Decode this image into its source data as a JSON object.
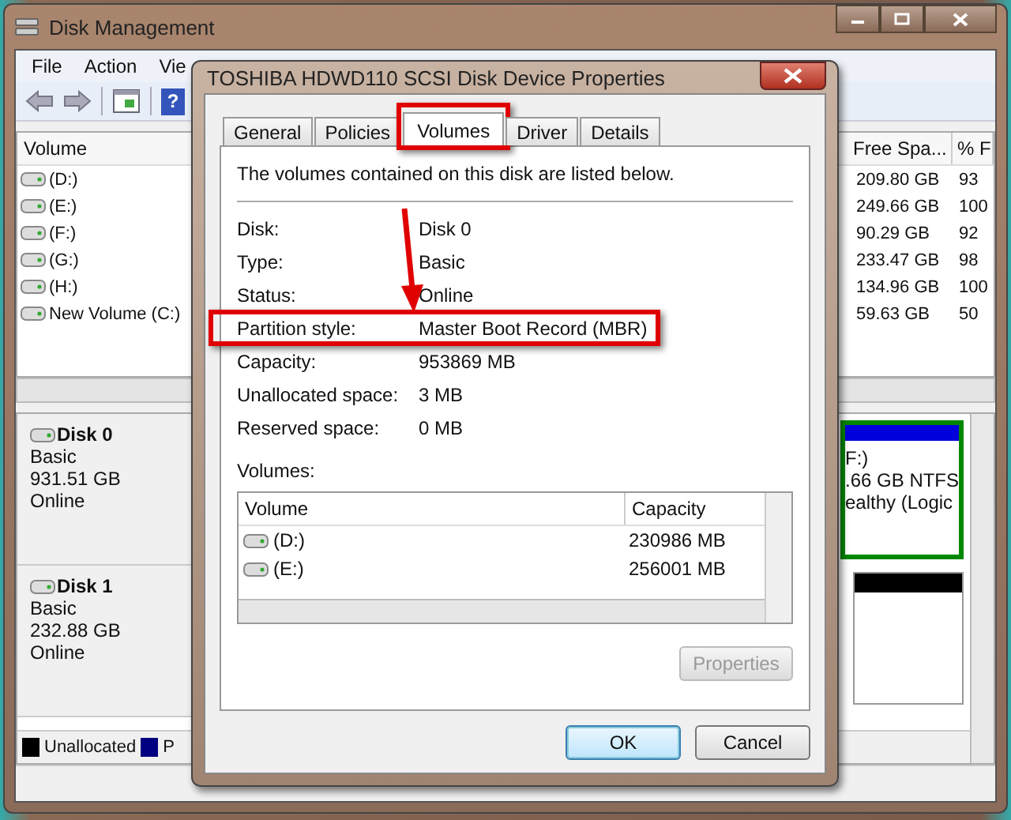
{
  "window": {
    "title": "Disk Management"
  },
  "menu": [
    {
      "label": "File"
    },
    {
      "label": "Action"
    },
    {
      "label": "Vie"
    }
  ],
  "toolbar": [
    {
      "kind": "back"
    },
    {
      "kind": "forward"
    },
    {
      "kind": "panel"
    },
    {
      "kind": "help",
      "glyph": "?"
    }
  ],
  "volume_list": {
    "columns": {
      "volume": "Volume",
      "free": "Free Spa...",
      "pct": "% F"
    },
    "rows": [
      {
        "volume": "(D:)",
        "free": "209.80 GB",
        "pct": "93"
      },
      {
        "volume": "(E:)",
        "free": "249.66 GB",
        "pct": "100"
      },
      {
        "volume": "(F:)",
        "free": "90.29 GB",
        "pct": "92"
      },
      {
        "volume": "(G:)",
        "free": "233.47 GB",
        "pct": "98"
      },
      {
        "volume": "(H:)",
        "free": "134.96 GB",
        "pct": "100"
      },
      {
        "volume": "New Volume (C:)",
        "free": "59.63 GB",
        "pct": "50"
      }
    ]
  },
  "disks": [
    {
      "name": "Disk 0",
      "type": "Basic",
      "size": "931.51 GB",
      "status": "Online",
      "partition": {
        "lines": [
          "F:)",
          ".66 GB NTFS",
          "ealthy (Logic"
        ]
      }
    },
    {
      "name": "Disk 1",
      "type": "Basic",
      "size": "232.88 GB",
      "status": "Online"
    }
  ],
  "legend": [
    {
      "label": "Unallocated",
      "color": "#000000"
    },
    {
      "label": "P",
      "color": "#000080"
    }
  ],
  "dialog": {
    "title": "TOSHIBA HDWD110 SCSI Disk Device Properties",
    "tabs": [
      {
        "label": "General",
        "selected": false,
        "highlighted": false
      },
      {
        "label": "Policies",
        "selected": false,
        "highlighted": false
      },
      {
        "label": "Volumes",
        "selected": true,
        "highlighted": true
      },
      {
        "label": "Driver",
        "selected": false,
        "highlighted": false
      },
      {
        "label": "Details",
        "selected": false,
        "highlighted": false
      }
    ],
    "intro": "The volumes contained on this disk are listed below.",
    "properties": [
      {
        "label": "Disk:",
        "value": "Disk 0",
        "highlighted": false
      },
      {
        "label": "Type:",
        "value": "Basic",
        "highlighted": false
      },
      {
        "label": "Status:",
        "value": "Online",
        "highlighted": false
      },
      {
        "label": "Partition style:",
        "value": "Master Boot Record (MBR)",
        "highlighted": true
      },
      {
        "label": "Capacity:",
        "value": "953869 MB",
        "highlighted": false
      },
      {
        "label": "Unallocated space:",
        "value": "3 MB",
        "highlighted": false
      },
      {
        "label": "Reserved space:",
        "value": "0 MB",
        "highlighted": false
      }
    ],
    "volumes_label": "Volumes:",
    "volumes_table": {
      "columns": [
        "Volume",
        "Capacity"
      ],
      "rows": [
        [
          "(D:)",
          "230986 MB"
        ],
        [
          "(E:)",
          "256001 MB"
        ]
      ]
    },
    "properties_button": {
      "label": "Properties",
      "disabled": true
    },
    "buttons": [
      {
        "label": "OK",
        "default": true
      },
      {
        "label": "Cancel",
        "default": false
      }
    ]
  }
}
